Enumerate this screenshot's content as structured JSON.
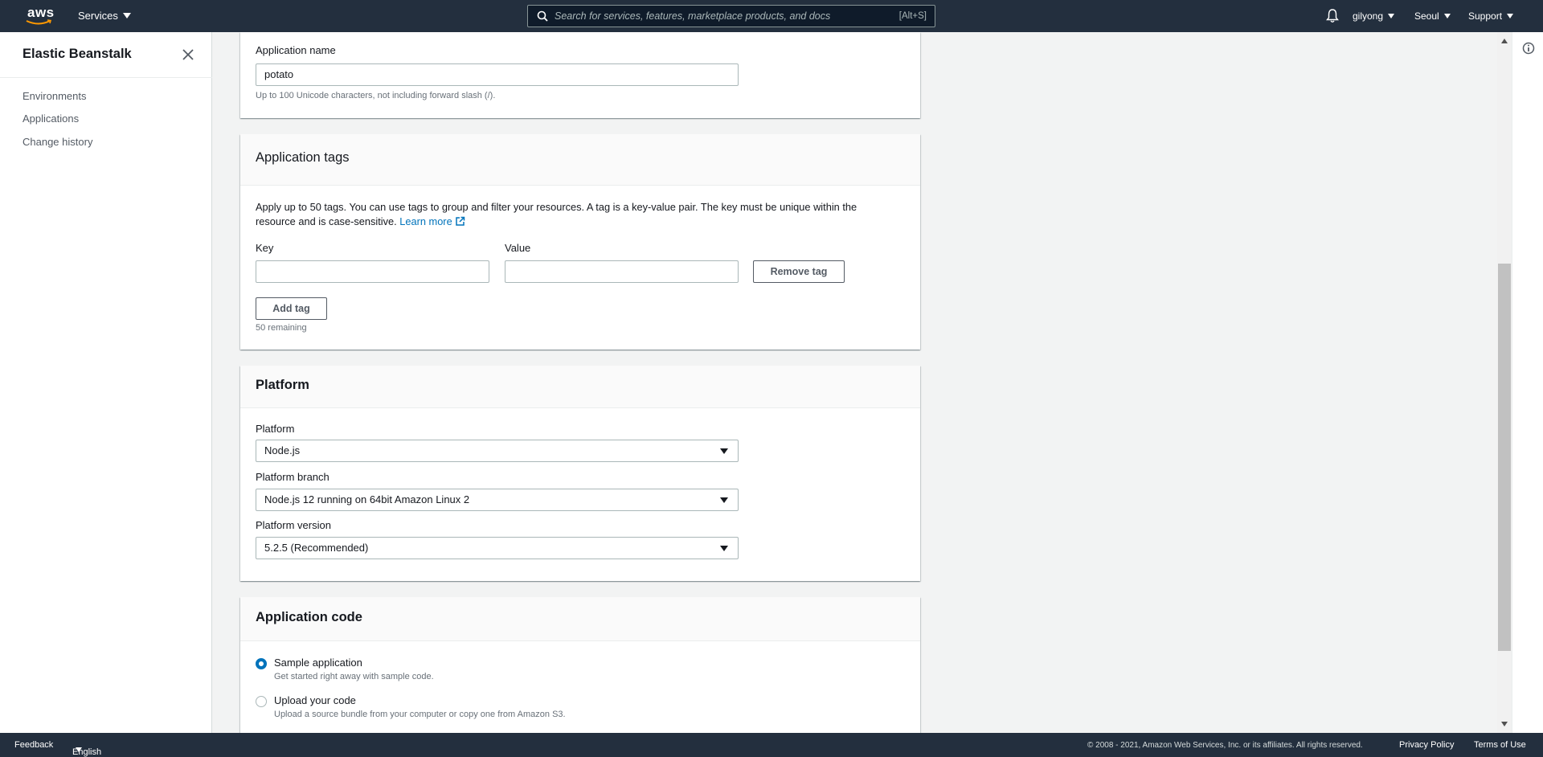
{
  "topnav": {
    "logo_text": "aws",
    "services_label": "Services",
    "search_placeholder": "Search for services, features, marketplace products, and docs",
    "search_shortcut": "[Alt+S]",
    "user_label": "gilyong",
    "region_label": "Seoul",
    "support_label": "Support"
  },
  "sidebar": {
    "title": "Elastic Beanstalk",
    "items": [
      {
        "label": "Environments"
      },
      {
        "label": "Applications"
      },
      {
        "label": "Change history"
      }
    ]
  },
  "app_info": {
    "name_label": "Application name",
    "name_value": "potato",
    "name_hint": "Up to 100 Unicode characters, not including forward slash (/)."
  },
  "tags": {
    "title": "Application tags",
    "description": "Apply up to 50 tags. You can use tags to group and filter your resources. A tag is a key-value pair. The key must be unique within the",
    "description2": "resource and is case-sensitive.",
    "learn_more": "Learn more",
    "key_label": "Key",
    "value_label": "Value",
    "key_value": "",
    "value_value": "",
    "remove_label": "Remove tag",
    "add_label": "Add tag",
    "remaining": "50 remaining"
  },
  "platform": {
    "title": "Platform",
    "platform_label": "Platform",
    "platform_value": "Node.js",
    "branch_label": "Platform branch",
    "branch_value": "Node.js 12 running on 64bit Amazon Linux 2",
    "version_label": "Platform version",
    "version_value": "5.2.5 (Recommended)"
  },
  "code": {
    "title": "Application code",
    "options": [
      {
        "label": "Sample application",
        "desc": "Get started right away with sample code.",
        "selected": true
      },
      {
        "label": "Upload your code",
        "desc": "Upload a source bundle from your computer or copy one from Amazon S3.",
        "selected": false
      }
    ]
  },
  "footer": {
    "feedback": "Feedback",
    "language": "English (US)",
    "copyright": "© 2008 - 2021, Amazon Web Services, Inc. or its affiliates. All rights reserved.",
    "privacy": "Privacy Policy",
    "terms": "Terms of Use"
  },
  "colors": {
    "nav_bg": "#232f3e",
    "link": "#0073bb",
    "page_bg": "#f2f3f3"
  }
}
